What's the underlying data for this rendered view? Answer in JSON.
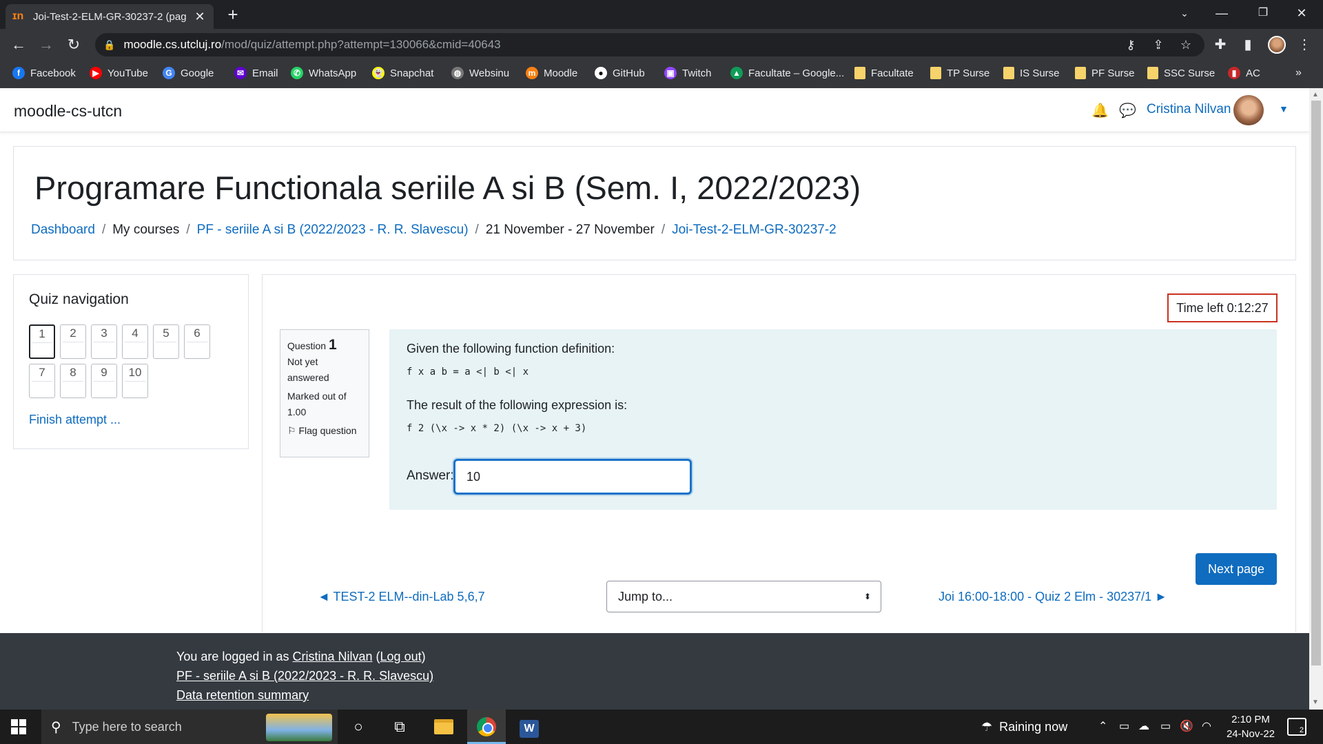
{
  "browser": {
    "tab_title": "Joi-Test-2-ELM-GR-30237-2 (pag",
    "tab_favicon": "ɪn",
    "url_host": "moodle.cs.utcluj.ro",
    "url_path": "/mod/quiz/attempt.php?attempt=130066&cmid=40643",
    "bookmarks": [
      {
        "label": "Facebook",
        "icon": "f",
        "color": "#1877f2"
      },
      {
        "label": "YouTube",
        "icon": "▶",
        "color": "#ff0000"
      },
      {
        "label": "Google",
        "icon": "G",
        "color": "#4285f4"
      },
      {
        "label": "Email",
        "icon": "✉",
        "color": "#6001d2"
      },
      {
        "label": "WhatsApp",
        "icon": "✆",
        "color": "#25d366"
      },
      {
        "label": "Snapchat",
        "icon": "👻",
        "color": "#fffc00"
      },
      {
        "label": "Websinu",
        "icon": "◍",
        "color": "#777777"
      },
      {
        "label": "Moodle",
        "icon": "m",
        "color": "#f98012"
      },
      {
        "label": "GitHub",
        "icon": "●",
        "color": "#ffffff"
      },
      {
        "label": "Twitch",
        "icon": "▣",
        "color": "#9146ff"
      },
      {
        "label": "Facultate – Google...",
        "icon": "▲",
        "color": "#0f9d58"
      },
      {
        "label": "Facultate",
        "icon": "folder",
        "color": "#f6d36b"
      },
      {
        "label": "TP Surse",
        "icon": "folder",
        "color": "#f6d36b"
      },
      {
        "label": "IS Surse",
        "icon": "folder",
        "color": "#f6d36b"
      },
      {
        "label": "PF Surse",
        "icon": "folder",
        "color": "#f6d36b"
      },
      {
        "label": "SSC Surse",
        "icon": "folder",
        "color": "#f6d36b"
      },
      {
        "label": "AC",
        "icon": "▮",
        "color": "#c62828"
      }
    ],
    "bookmarks_more": "»"
  },
  "moodle": {
    "brand": "moodle-cs-utcn",
    "user_name": "Cristina Nilvan",
    "page_title": "Programare Functionala seriile A si B (Sem. I, 2022/2023)",
    "breadcrumb": [
      {
        "label": "Dashboard",
        "link": true
      },
      {
        "label": "My courses",
        "link": false
      },
      {
        "label": "PF - seriile A si B (2022/2023 - R. R. Slavescu)",
        "link": true
      },
      {
        "label": "21 November - 27 November",
        "link": false
      },
      {
        "label": "Joi-Test-2-ELM-GR-30237-2",
        "link": true
      }
    ],
    "breadcrumb_sep": "/",
    "quiz_nav": {
      "title": "Quiz navigation",
      "questions": [
        "1",
        "2",
        "3",
        "4",
        "5",
        "6",
        "7",
        "8",
        "9",
        "10"
      ],
      "current": "1",
      "finish_label": "Finish attempt ..."
    },
    "timer": "Time left 0:12:27",
    "question": {
      "label": "Question",
      "number": "1",
      "status": "Not yet answered",
      "marks": "Marked out of 1.00",
      "flag_label": "Flag question",
      "text1": "Given the following function definition:",
      "code1": "f x a b = a <| b <| x",
      "text2": "The result of the following expression is:",
      "code2": "f 2 (\\x -> x * 2) (\\x -> x + 3)",
      "answer_label": "Answer:",
      "answer_value": "10"
    },
    "next_page_label": "Next page",
    "prev_activity": "◄ TEST-2 ELM--din-Lab 5,6,7",
    "jump_placeholder": "Jump to...",
    "next_activity": "Joi 16:00-18:00 - Quiz 2 Elm - 30237/1 ►",
    "footer": {
      "logged_in_prefix": "You are logged in as",
      "user": "Cristina Nilvan",
      "logout": "Log out",
      "course": "PF - seriile A si B (2022/2023 - R. R. Slavescu)",
      "retention": "Data retention summary"
    }
  },
  "taskbar": {
    "search_placeholder": "Type here to search",
    "weather": "Raining now",
    "time": "2:10 PM",
    "date": "24-Nov-22",
    "notifications": "2"
  }
}
